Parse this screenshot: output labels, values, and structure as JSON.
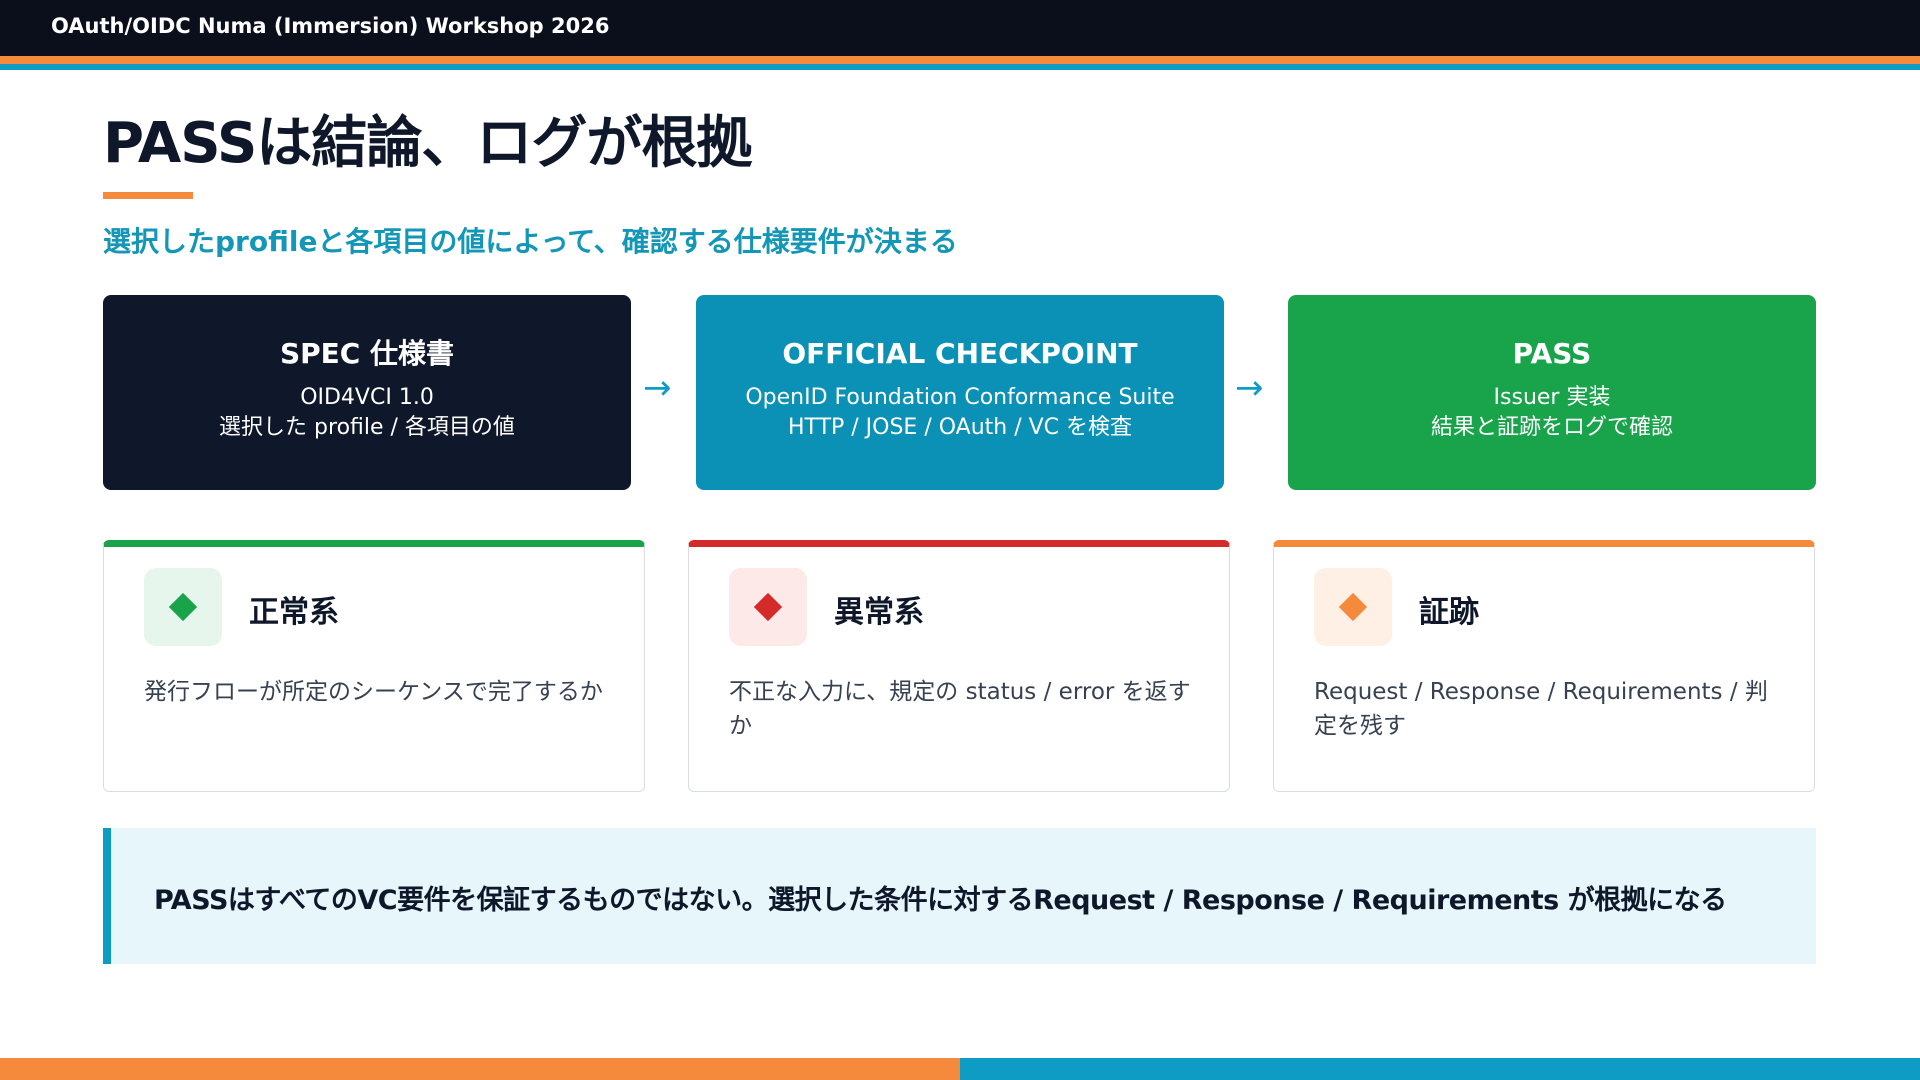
{
  "header": {
    "title": "OAuth/OIDC Numa (Immersion) Workshop 2026"
  },
  "slide": {
    "title": "PASSは結論、ログが根拠",
    "subtitle": "選択したprofileと各項目の値によって、確認する仕様要件が決まる"
  },
  "flow": [
    {
      "title": "SPEC 仕様書",
      "line1": "OID4VCI 1.0",
      "line2": "選択した profile / 各項目の値",
      "color": "#0f172a"
    },
    {
      "title": "OFFICIAL CHECKPOINT",
      "line1": "OpenID Foundation Conformance Suite",
      "line2": "HTTP / JOSE / OAuth / VC を検査",
      "color": "#0b91b6"
    },
    {
      "title": "PASS",
      "line1": "Issuer 実装",
      "line2": "結果と証跡をログで確認",
      "color": "#19a44c"
    }
  ],
  "arrow_glyph": "→",
  "cards": [
    {
      "icon": "diamond-icon",
      "title": "正常系",
      "body": "発行フローが所定のシーケンスで完了するか",
      "accent": "#19a44c"
    },
    {
      "icon": "diamond-icon",
      "title": "異常系",
      "body": "不正な入力に、規定の status / error を返すか",
      "accent": "#d42a2a"
    },
    {
      "icon": "diamond-icon",
      "title": "証跡",
      "body": "Request / Response / Requirements / 判定を残す",
      "accent": "#f58a3c"
    }
  ],
  "callout": {
    "text": "PASSはすべてのVC要件を保証するものではない。選択した条件に対するRequest / Response / Requirements が根拠になる"
  },
  "colors": {
    "navy": "#0b0f1c",
    "orange": "#f58a3c",
    "teal": "#0e9cc4",
    "green": "#19a44c",
    "red": "#d42a2a"
  }
}
